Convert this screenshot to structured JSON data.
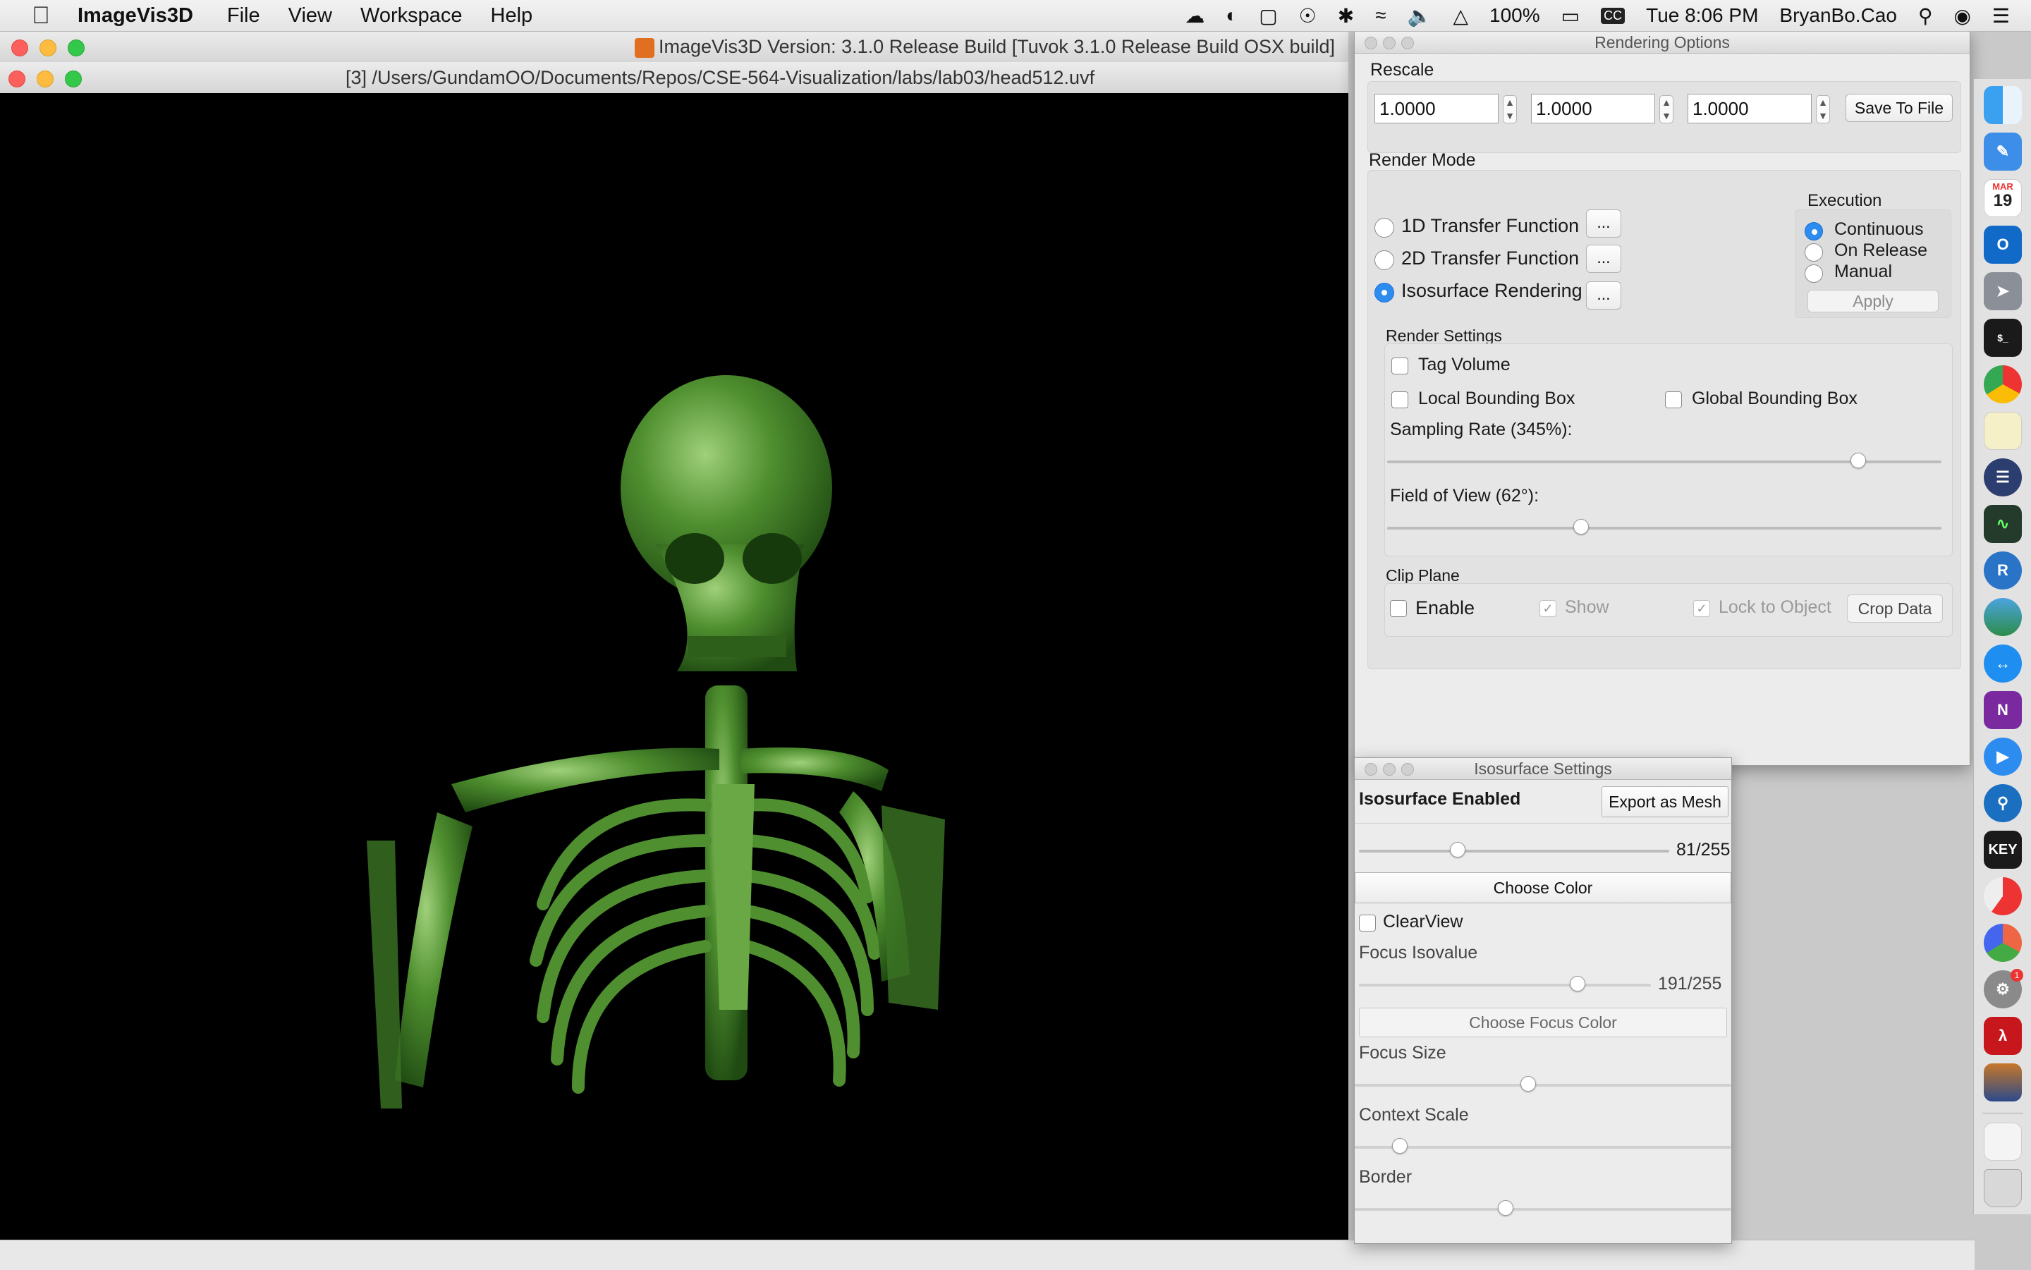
{
  "menubar": {
    "app_name": "ImageVis3D",
    "menus": [
      "File",
      "View",
      "Workspace",
      "Help"
    ],
    "battery": "100%",
    "clock": "Tue 8:06 PM",
    "user": "BryanBo.Cao"
  },
  "main_window": {
    "title": "ImageVis3D Version: 3.1.0 Release Build [Tuvok 3.1.0 Release Build OSX build]",
    "doc_title": "[3] /Users/GundamOO/Documents/Repos/CSE-564-Visualization/labs/lab03/head512.uvf",
    "render_color": "#5a9a3c"
  },
  "rendering_options": {
    "title": "Rendering Options",
    "rescale": {
      "label": "Rescale",
      "values": [
        "1.0000",
        "1.0000",
        "1.0000"
      ],
      "save_button": "Save To File"
    },
    "render_mode": {
      "label": "Render Mode",
      "options": [
        "1D Transfer Function",
        "2D Transfer Function",
        "Isosurface Rendering"
      ],
      "selected": "Isosurface Rendering",
      "ellipsis": "..."
    },
    "execution": {
      "label": "Execution",
      "options": [
        "Continuous",
        "On Release",
        "Manual"
      ],
      "selected": "Continuous",
      "apply": "Apply"
    },
    "render_settings": {
      "label": "Render Settings",
      "tag_volume": "Tag Volume",
      "local_bbox": "Local Bounding Box",
      "global_bbox": "Global Bounding Box",
      "sampling_label": "Sampling Rate (345%):",
      "sampling_fraction": 0.85,
      "fov_label": "Field of View (62°):",
      "fov_fraction": 0.35
    },
    "clip_plane": {
      "label": "Clip Plane",
      "enable": "Enable",
      "show": "Show",
      "lock": "Lock to Object",
      "crop": "Crop Data"
    }
  },
  "isosurface_settings": {
    "title": "Isosurface Settings",
    "enabled_label": "Isosurface Enabled",
    "export_button": "Export as Mesh",
    "isovalue": "81/255",
    "isovalue_fraction": 0.318,
    "choose_color": "Choose Color",
    "clearview": "ClearView",
    "focus_isovalue_label": "Focus Isovalue",
    "focus_isovalue": "191/255",
    "focus_fraction": 0.749,
    "choose_focus_color": "Choose Focus Color",
    "focus_size_label": "Focus Size",
    "focus_size_fraction": 0.46,
    "context_scale_label": "Context Scale",
    "context_scale_fraction": 0.12,
    "border_label": "Border",
    "border_fraction": 0.4
  },
  "dock": {
    "calendar_month": "MAR",
    "calendar_day": "19",
    "keynote": "KEY",
    "outlook": "O",
    "onenote": "N",
    "r": "R",
    "badge": "1"
  }
}
